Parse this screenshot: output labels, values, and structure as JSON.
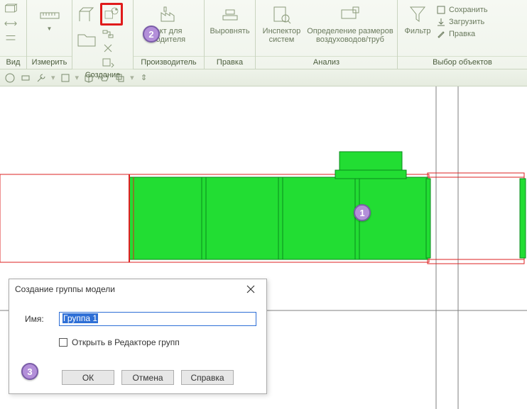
{
  "ribbon": {
    "panels": {
      "view": {
        "title": "Вид"
      },
      "measure": {
        "title": "Измерить"
      },
      "create": {
        "title": "Создание"
      },
      "manufacturer": {
        "title": "Производитель",
        "btn1_l1": "ект для",
        "btn1_l2": "водителя"
      },
      "edit": {
        "title": "Правка",
        "btn1_l1": "Выровнять",
        "btn1_l2": ""
      },
      "analysis": {
        "title": "Анализ",
        "btn1_l1": "Инспектор",
        "btn1_l2": "систем",
        "btn2_l1": "Определение размеров",
        "btn2_l2": "воздуховодов/труб"
      },
      "selection": {
        "title": "Выбор объектов",
        "filter": "Фильтр",
        "save": "Сохранить",
        "load": "Загрузить",
        "edit": "Правка"
      }
    }
  },
  "dialog": {
    "title": "Создание группы модели",
    "name_label": "Имя:",
    "name_value": "Группа 1",
    "checkbox_label": "Открыть в Редакторе групп",
    "ok": "ОК",
    "cancel": "Отмена",
    "help": "Справка"
  },
  "badges": {
    "b1": "1",
    "b2": "2",
    "b3": "3"
  }
}
